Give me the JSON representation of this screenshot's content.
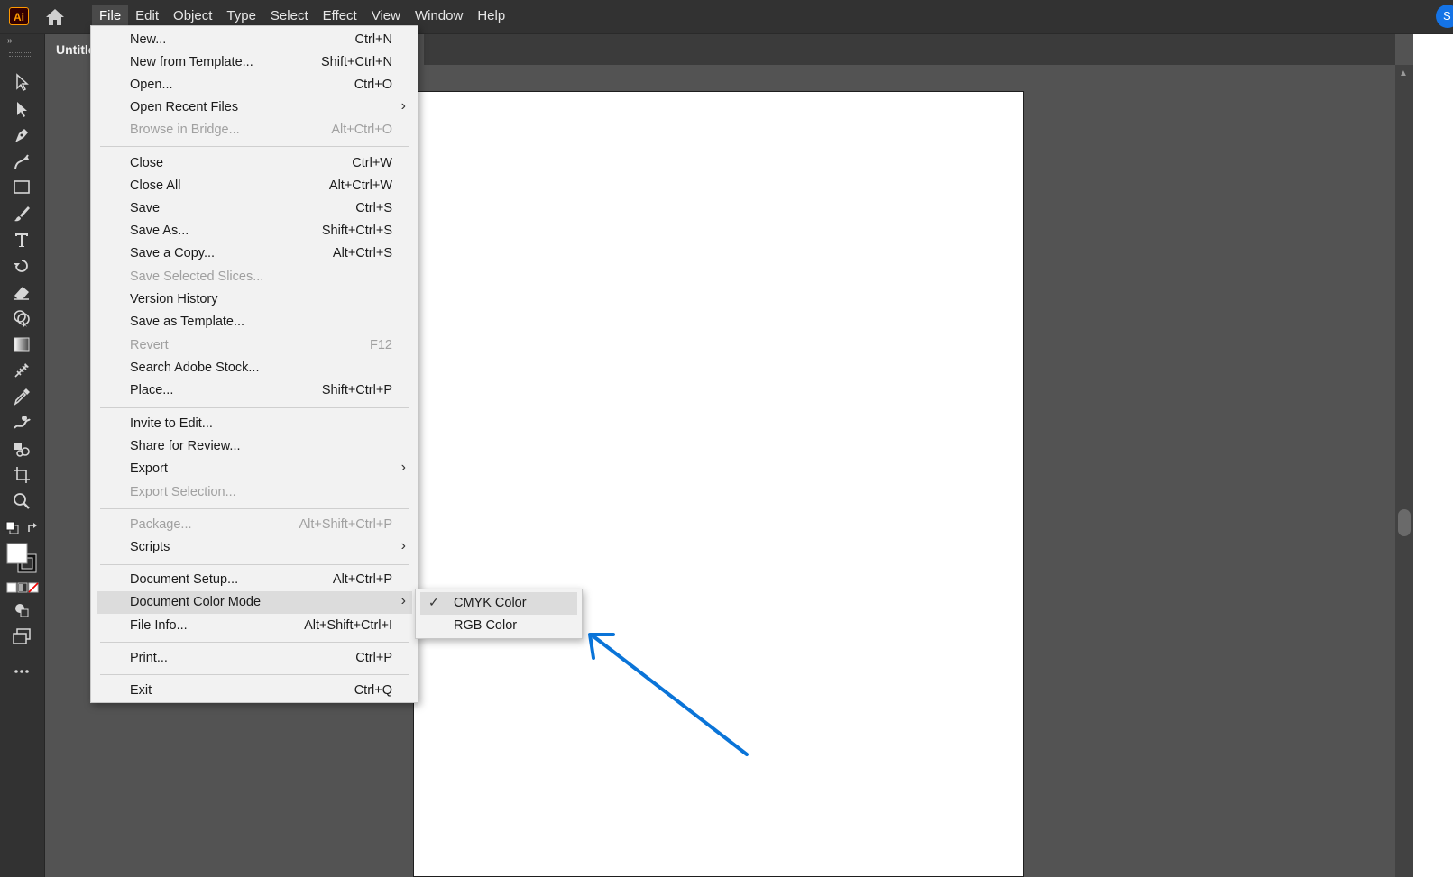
{
  "app": {
    "logo_text": "Ai",
    "avatar_text": "S",
    "accent_color": "#1473e6"
  },
  "menubar": {
    "items": [
      "File",
      "Edit",
      "Object",
      "Type",
      "Select",
      "Effect",
      "View",
      "Window",
      "Help"
    ],
    "active": "File"
  },
  "document": {
    "tab_title": "Untitled"
  },
  "file_menu": {
    "items": [
      {
        "label": "New...",
        "shortcut": "Ctrl+N"
      },
      {
        "label": "New from Template...",
        "shortcut": "Shift+Ctrl+N"
      },
      {
        "label": "Open...",
        "shortcut": "Ctrl+O"
      },
      {
        "label": "Open Recent Files",
        "shortcut": "",
        "submenu": true
      },
      {
        "label": "Browse in Bridge...",
        "shortcut": "Alt+Ctrl+O",
        "disabled": true
      },
      {
        "label": "Close",
        "shortcut": "Ctrl+W"
      },
      {
        "label": "Close All",
        "shortcut": "Alt+Ctrl+W"
      },
      {
        "label": "Save",
        "shortcut": "Ctrl+S"
      },
      {
        "label": "Save As...",
        "shortcut": "Shift+Ctrl+S"
      },
      {
        "label": "Save a Copy...",
        "shortcut": "Alt+Ctrl+S"
      },
      {
        "label": "Save Selected Slices...",
        "shortcut": "",
        "disabled": true
      },
      {
        "label": "Version History",
        "shortcut": ""
      },
      {
        "label": "Save as Template...",
        "shortcut": ""
      },
      {
        "label": "Revert",
        "shortcut": "F12",
        "disabled": true
      },
      {
        "label": "Search Adobe Stock...",
        "shortcut": ""
      },
      {
        "label": "Place...",
        "shortcut": "Shift+Ctrl+P"
      },
      {
        "label": "Invite to Edit...",
        "shortcut": ""
      },
      {
        "label": "Share for Review...",
        "shortcut": ""
      },
      {
        "label": "Export",
        "shortcut": "",
        "submenu": true
      },
      {
        "label": "Export Selection...",
        "shortcut": "",
        "disabled": true
      },
      {
        "label": "Package...",
        "shortcut": "Alt+Shift+Ctrl+P",
        "disabled": true
      },
      {
        "label": "Scripts",
        "shortcut": "",
        "submenu": true
      },
      {
        "label": "Document Setup...",
        "shortcut": "Alt+Ctrl+P"
      },
      {
        "label": "Document Color Mode",
        "shortcut": "",
        "submenu": true,
        "highlighted": true
      },
      {
        "label": "File Info...",
        "shortcut": "Alt+Shift+Ctrl+I"
      },
      {
        "label": "Print...",
        "shortcut": "Ctrl+P"
      },
      {
        "label": "Exit",
        "shortcut": "Ctrl+Q"
      }
    ]
  },
  "color_mode_submenu": {
    "items": [
      {
        "label": "CMYK Color",
        "checked": true
      },
      {
        "label": "RGB Color",
        "checked": false
      }
    ],
    "check_glyph": "✓",
    "submenu_arrow": "›"
  },
  "annotation": {
    "arrow_color": "#0a74d8"
  }
}
